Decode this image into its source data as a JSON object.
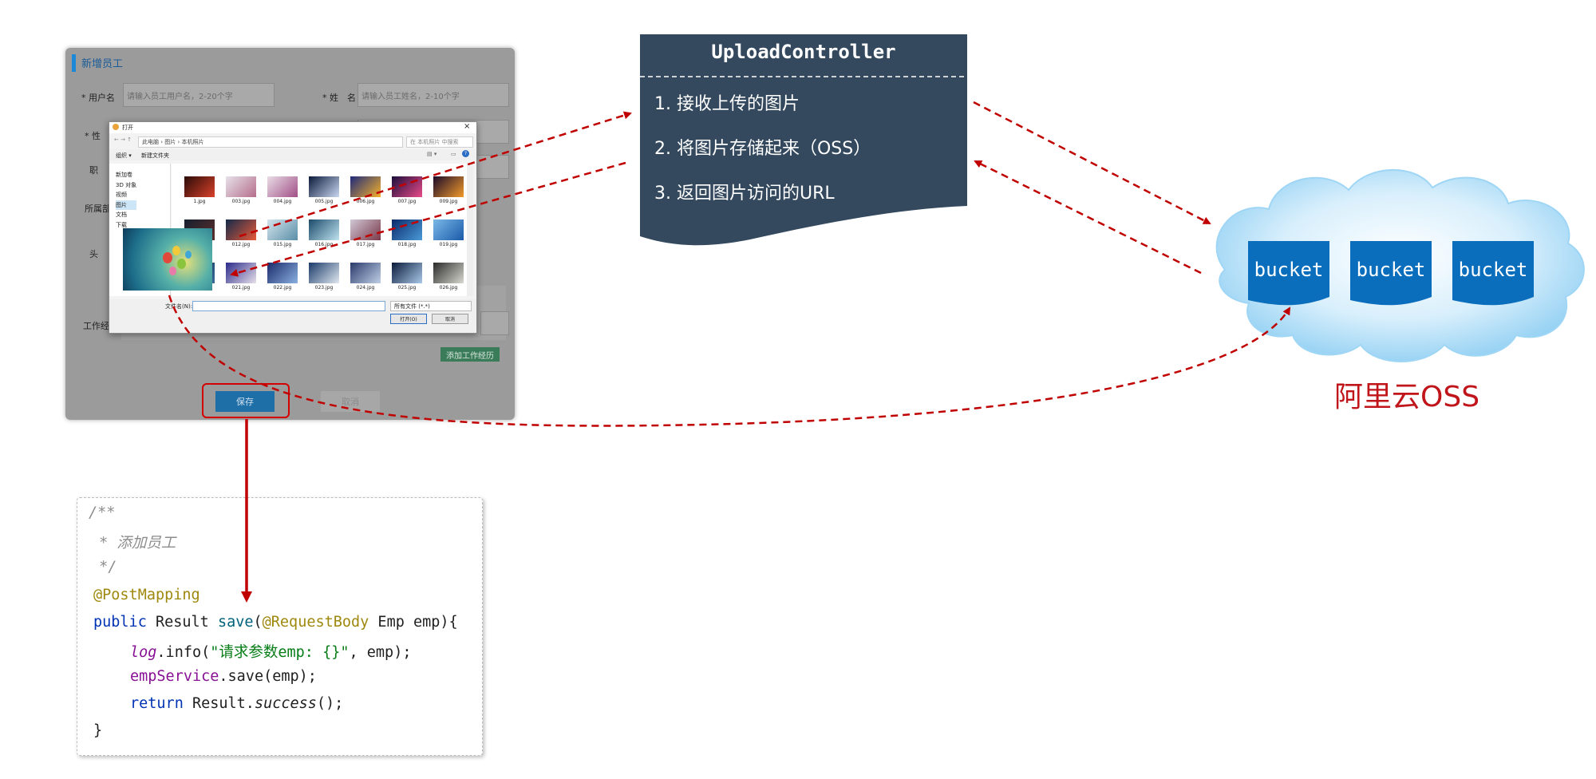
{
  "form": {
    "title": "新增员工",
    "labels": {
      "username": "* 用户名",
      "name": "* 姓　名",
      "gender": "* 性",
      "job": "职",
      "dept": "所属部",
      "avatar": "头",
      "work": "工作经"
    },
    "placeholders": {
      "username": "请输入员工用户名，2-20个字",
      "name": "请输入员工姓名，2-10个字"
    },
    "add_work_button": "添加工作经历",
    "save_button": "保存",
    "cancel_button": "取消"
  },
  "file_dialog": {
    "title": "打开",
    "breadcrumb": "此电脑  ›  图片  ›  本机照片",
    "search_placeholder": "在 本机照片 中搜索",
    "toolbar": {
      "organize": "组织 ▾",
      "new_folder": "新建文件夹"
    },
    "nav_items": [
      "新加卷",
      "3D 对象",
      "视频",
      "图片",
      "文档",
      "下载"
    ],
    "files": [
      "1.jpg",
      "003.jpg",
      "004.jpg",
      "005.jpg",
      "006.jpg",
      "007.jpg",
      "009.jpg",
      "",
      "012.jpg",
      "015.jpg",
      "016.jpg",
      "017.jpg",
      "018.jpg",
      "019.jpg",
      "",
      "021.jpg",
      "022.jpg",
      "023.jpg",
      "024.jpg",
      "025.jpg",
      "026.jpg"
    ],
    "filename_label": "文件名(N):",
    "filetype": "所有文件 (*.*)",
    "open_button": "打开(O)",
    "cancel_button": "取消"
  },
  "controller": {
    "title": "UploadController",
    "steps": [
      "1. 接收上传的图片",
      "2. 将图片存储起来（OSS）",
      "3. 返回图片访问的URL"
    ]
  },
  "oss": {
    "buckets": [
      "bucket",
      "bucket",
      "bucket"
    ],
    "label": "阿里云OSS"
  },
  "code": {
    "doc_open": "/**",
    "doc_text": " * 添加员工",
    "doc_close": " */",
    "annotation": "@PostMapping",
    "sig_public": "public",
    "sig_result": " Result ",
    "sig_method": "save",
    "sig_paren": "(",
    "sig_reqbody": "@RequestBody",
    "sig_params": " Emp emp){",
    "log_obj": "log",
    "log_call": ".info(",
    "log_str": "\"请求参数emp: {}\"",
    "log_rest": ", emp);",
    "svc_field": "empService",
    "svc_call": ".save(emp);",
    "ret_kw": "return",
    "ret_obj": " Result.",
    "ret_method": "success",
    "ret_end": "();",
    "close": "}"
  },
  "colors": {
    "controller_bg": "#34495e",
    "arrow_red": "#c00000",
    "oss_red": "#c0151a",
    "bucket_blue": "#0a6ebd",
    "cloud_light": "#bfe3f8"
  }
}
